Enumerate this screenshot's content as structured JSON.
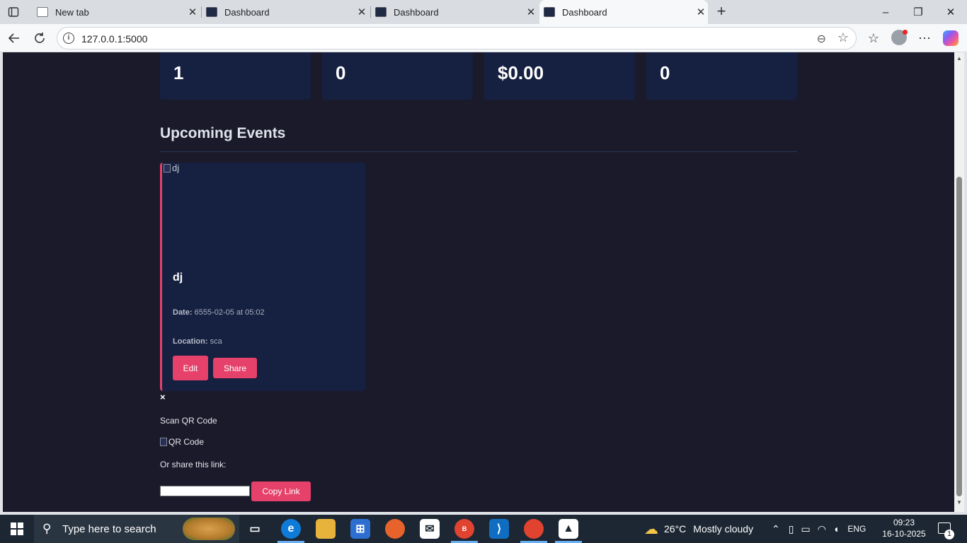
{
  "browser": {
    "tabs": [
      {
        "title": "New tab",
        "active": false
      },
      {
        "title": "Dashboard",
        "active": false
      },
      {
        "title": "Dashboard",
        "active": false
      },
      {
        "title": "Dashboard",
        "active": true
      }
    ],
    "url": "127.0.0.1:5000"
  },
  "stats": [
    {
      "value": "1"
    },
    {
      "value": "0"
    },
    {
      "value": "$0.00"
    },
    {
      "value": "0"
    }
  ],
  "events_section": {
    "title": "Upcoming Events"
  },
  "event": {
    "image_alt": "dj",
    "name": "dj",
    "date_label": "Date:",
    "date_value": "6555-02-05 at 05:02",
    "location_label": "Location:",
    "location_value": "sca",
    "edit_label": "Edit",
    "share_label": "Share"
  },
  "share_modal": {
    "close_glyph": "×",
    "heading": "Scan QR Code",
    "qr_alt": "QR Code",
    "link_label": "Or share this link:",
    "link_value": "",
    "copy_label": "Copy Link"
  },
  "taskbar": {
    "search_placeholder": "Type here to search",
    "weather_temp": "26°C",
    "weather_desc": "Mostly cloudy",
    "language": "ENG",
    "time": "09:23",
    "date": "16-10-2025",
    "notification_count": "1",
    "chrome_badge": "B"
  },
  "colors": {
    "page_bg": "#1b1a2b",
    "card_bg": "#162040",
    "accent": "#e6416a"
  }
}
